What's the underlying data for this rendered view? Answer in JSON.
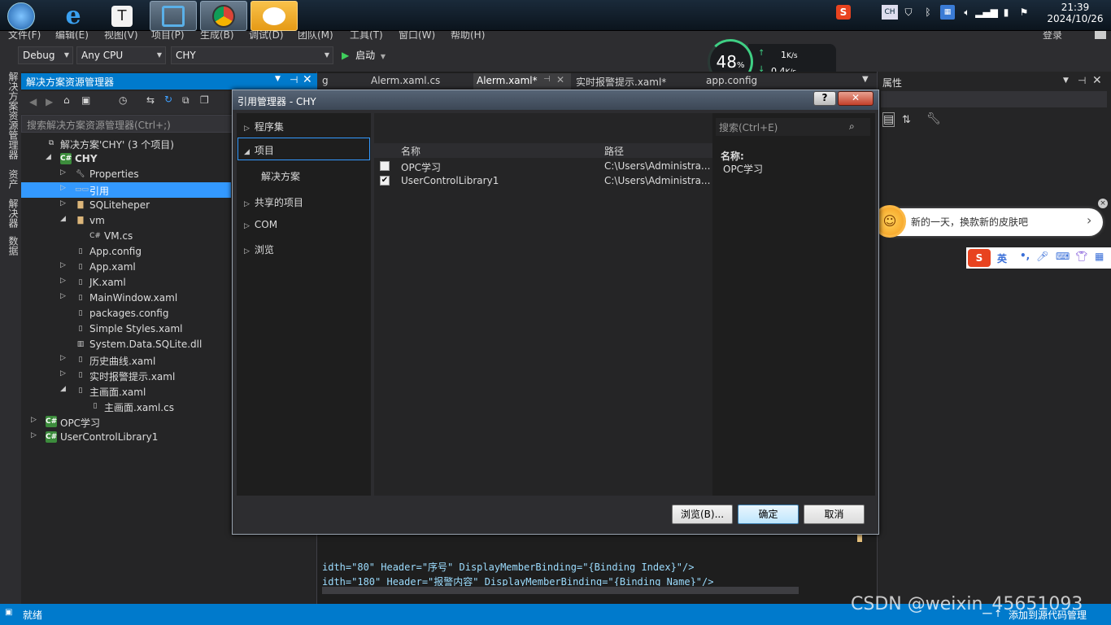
{
  "taskbar": {
    "apps": [
      {
        "name": "start-button",
        "label": ""
      },
      {
        "name": "ie-app",
        "label": "e"
      },
      {
        "name": "typora-app",
        "label": "T"
      },
      {
        "name": "visual-studio-app",
        "label": ""
      },
      {
        "name": "chrome-app",
        "label": ""
      },
      {
        "name": "wechat-app",
        "label": ""
      }
    ],
    "tray_text": "CH",
    "clock_time": "21:39",
    "clock_date": "2024/10/26"
  },
  "menu": {
    "items": [
      "文件(F)",
      "编辑(E)",
      "视图(V)",
      "项目(P)",
      "生成(B)",
      "调试(D)",
      "团队(M)",
      "工具(T)",
      "窗口(W)",
      "帮助(H)"
    ],
    "login": "登录"
  },
  "toolbar": {
    "config": "Debug",
    "platform": "Any CPU",
    "project": "CHY",
    "start_label": "启动"
  },
  "meter": {
    "percent": "48",
    "percent_suffix": "%",
    "up": "1",
    "down": "0.4",
    "unit": "K/s"
  },
  "vertical_tabs": [
    "解决方案资源管理器",
    "资产",
    "解决器",
    "数据"
  ],
  "solution_explorer": {
    "title": "解决方案资源管理器",
    "search_placeholder": "搜索解决方案资源管理器(Ctrl+;)",
    "tree": [
      {
        "label": "解决方案'CHY' (3 个项目)",
        "indent": 0,
        "tri": "",
        "icon": "solution"
      },
      {
        "label": "CHY",
        "indent": 1,
        "tri": "◢",
        "icon": "cs",
        "bold": true
      },
      {
        "label": "Properties",
        "indent": 2,
        "tri": "▷",
        "icon": "wrench"
      },
      {
        "label": "引用",
        "indent": 2,
        "tri": "▷",
        "icon": "ref",
        "selected": true
      },
      {
        "label": "SQLiteheper",
        "indent": 2,
        "tri": "▷",
        "icon": "folder"
      },
      {
        "label": "vm",
        "indent": 2,
        "tri": "◢",
        "icon": "folder"
      },
      {
        "label": "VM.cs",
        "indent": 3,
        "tri": "",
        "icon": "cfile"
      },
      {
        "label": "App.config",
        "indent": 2,
        "tri": "",
        "icon": "file"
      },
      {
        "label": "App.xaml",
        "indent": 2,
        "tri": "▷",
        "icon": "file"
      },
      {
        "label": "JK.xaml",
        "indent": 2,
        "tri": "▷",
        "icon": "file"
      },
      {
        "label": "MainWindow.xaml",
        "indent": 2,
        "tri": "▷",
        "icon": "file"
      },
      {
        "label": "packages.config",
        "indent": 2,
        "tri": "",
        "icon": "file"
      },
      {
        "label": "Simple Styles.xaml",
        "indent": 2,
        "tri": "",
        "icon": "file"
      },
      {
        "label": "System.Data.SQLite.dll",
        "indent": 2,
        "tri": "",
        "icon": "dll"
      },
      {
        "label": "历史曲线.xaml",
        "indent": 2,
        "tri": "▷",
        "icon": "file"
      },
      {
        "label": "实时报警提示.xaml",
        "indent": 2,
        "tri": "▷",
        "icon": "file"
      },
      {
        "label": "主画面.xaml",
        "indent": 2,
        "tri": "◢",
        "icon": "file"
      },
      {
        "label": "主画面.xaml.cs",
        "indent": 3,
        "tri": "",
        "icon": "file"
      },
      {
        "label": "OPC学习",
        "indent": 0,
        "tri": "▷",
        "icon": "cs"
      },
      {
        "label": "UserControlLibrary1",
        "indent": 0,
        "tri": "▷",
        "icon": "cs"
      }
    ]
  },
  "editor": {
    "tabs": [
      "g",
      "Alerm.xaml.cs",
      "Alerm.xaml*",
      "实时报警提示.xaml*",
      "app.config"
    ],
    "code_lines": [
      "idth=\"80\" Header=\"序号\" DisplayMemberBinding=\"{Binding Index}\"/>",
      "idth=\"180\" Header=\"报警内容\" DisplayMemberBinding=\"{Binding Name}\"/>"
    ]
  },
  "properties": {
    "title": "属性"
  },
  "dialog": {
    "title": "引用管理器 - CHY",
    "help": "?",
    "nav": [
      {
        "label": "程序集",
        "tri": "▷",
        "selected": false,
        "child": false
      },
      {
        "label": "项目",
        "tri": "◢",
        "selected": true,
        "child": false
      },
      {
        "label": "解决方案",
        "tri": "",
        "selected": false,
        "child": true
      },
      {
        "label": "共享的项目",
        "tri": "▷",
        "selected": false,
        "child": false
      },
      {
        "label": "COM",
        "tri": "▷",
        "selected": false,
        "child": false
      },
      {
        "label": "浏览",
        "tri": "▷",
        "selected": false,
        "child": false
      }
    ],
    "search_placeholder": "搜索(Ctrl+E)",
    "columns": {
      "name": "名称",
      "path": "路径"
    },
    "rows": [
      {
        "checked": false,
        "name": "OPC学习",
        "path": "C:\\Users\\Administra..."
      },
      {
        "checked": true,
        "name": "UserControlLibrary1",
        "path": "C:\\Users\\Administra..."
      }
    ],
    "detail_label": "名称:",
    "detail_value": "OPC学习",
    "buttons": {
      "browse": "浏览(B)...",
      "ok": "确定",
      "cancel": "取消"
    }
  },
  "popup": {
    "text": "新的一天，换款新的皮肤吧",
    "arrow": "›",
    "close": "×"
  },
  "ime": {
    "logo": "S",
    "mode": "英",
    "punct": "•,"
  },
  "status": {
    "text": "就绪",
    "right": "添加到源代码管理"
  },
  "watermark": "CSDN @weixin_45651093"
}
